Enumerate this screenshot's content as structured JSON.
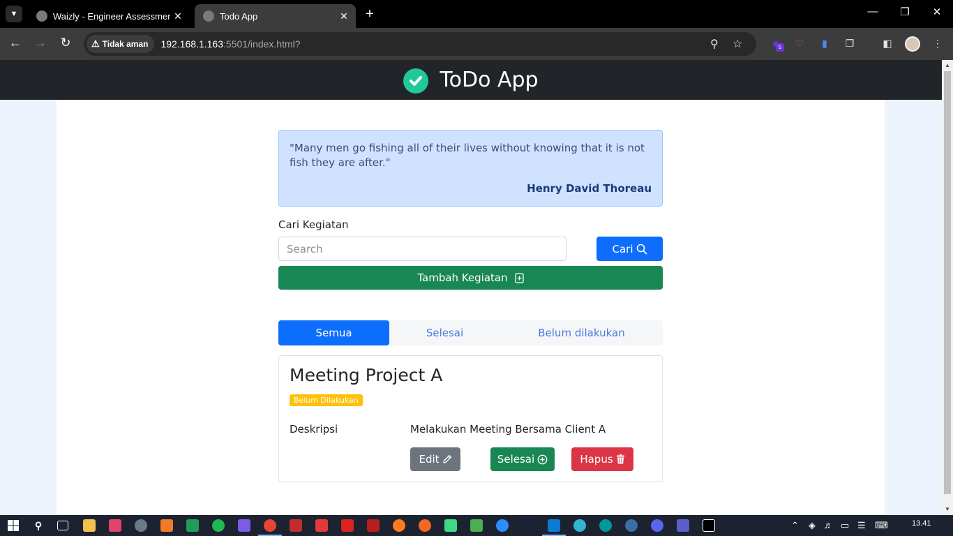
{
  "browser": {
    "tabs": [
      {
        "title": "Waizly - Engineer Assessment",
        "active": false
      },
      {
        "title": "Todo App",
        "active": true
      }
    ],
    "security_label": "Tidak aman",
    "url_host": "192.168.1.163",
    "url_rest": ":5501/index.html?",
    "extension_badge": "5"
  },
  "app": {
    "title": "ToDo App",
    "quote": {
      "text": "\"Many men go fishing all of their lives without knowing that it is not fish they are after.\"",
      "author": "Henry David Thoreau"
    },
    "search": {
      "label": "Cari Kegiatan",
      "placeholder": "Search",
      "button_label": "Cari"
    },
    "add_button_label": "Tambah Kegiatan",
    "filter_tabs": [
      {
        "label": "Semua",
        "active": true
      },
      {
        "label": "Selesai",
        "active": false
      },
      {
        "label": "Belum dilakukan",
        "active": false
      }
    ],
    "todos": [
      {
        "title": "Meeting Project A",
        "status": "Belum Dilakukan",
        "description_label": "Deskripsi",
        "description": "Melakukan Meeting Bersama Client A",
        "edit_label": "Edit",
        "done_label": "Selesai",
        "delete_label": "Hapus"
      }
    ]
  },
  "colors": {
    "primary": "#0d6efd",
    "success": "#198754",
    "danger": "#dc3545",
    "secondary": "#6c757d",
    "warning": "#ffc107",
    "header": "#212529"
  },
  "taskbar": {
    "clock": "13.41"
  }
}
